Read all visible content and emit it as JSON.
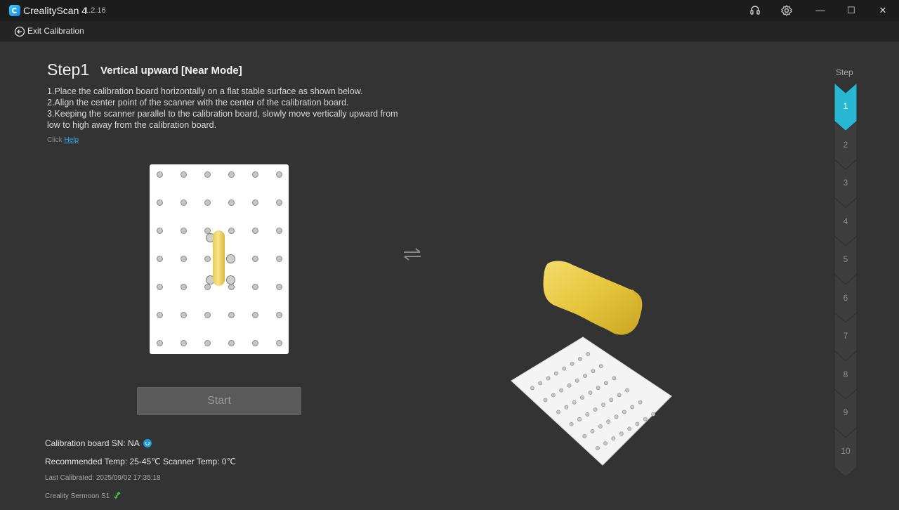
{
  "titlebar": {
    "app_name": "CrealityScan 4",
    "version": "1.2.16",
    "icons": [
      "headset-icon",
      "gear-icon",
      "minimize-icon",
      "maximize-icon",
      "close-icon"
    ]
  },
  "subbar": {
    "exit_label": "Exit Calibration"
  },
  "step": {
    "title": "Step1",
    "subtitle": "Vertical upward [Near Mode]",
    "instructions": [
      "1.Place the calibration board horizontally on a flat stable surface as shown below.",
      "2.Align the center point of the scanner with the center of the calibration board.",
      "3.Keeping the scanner parallel to the calibration board, slowly move vertically upward from",
      "low to high away from the calibration board."
    ],
    "help_prefix": "Click",
    "help_link": "Help"
  },
  "start_button": "Start",
  "info": {
    "sn_label": "Calibration board SN: NA",
    "temp_label": "Recommended Temp: 25-45℃ Scanner Temp: 0℃",
    "last_calibrated": "Last Calibrated: 2025/09/02 17:35:18",
    "device_name": "Creality Sermoon S1"
  },
  "stepper": {
    "label": "Step",
    "steps": [
      "1",
      "2",
      "3",
      "4",
      "5",
      "6",
      "7",
      "8",
      "9",
      "10"
    ],
    "active_step": 1
  },
  "colors": {
    "accent": "#27b7d3",
    "background": "#333333",
    "titlebar": "#1c1c1c",
    "link": "#39a7e6",
    "scanner_yellow": "#e8cb52"
  }
}
